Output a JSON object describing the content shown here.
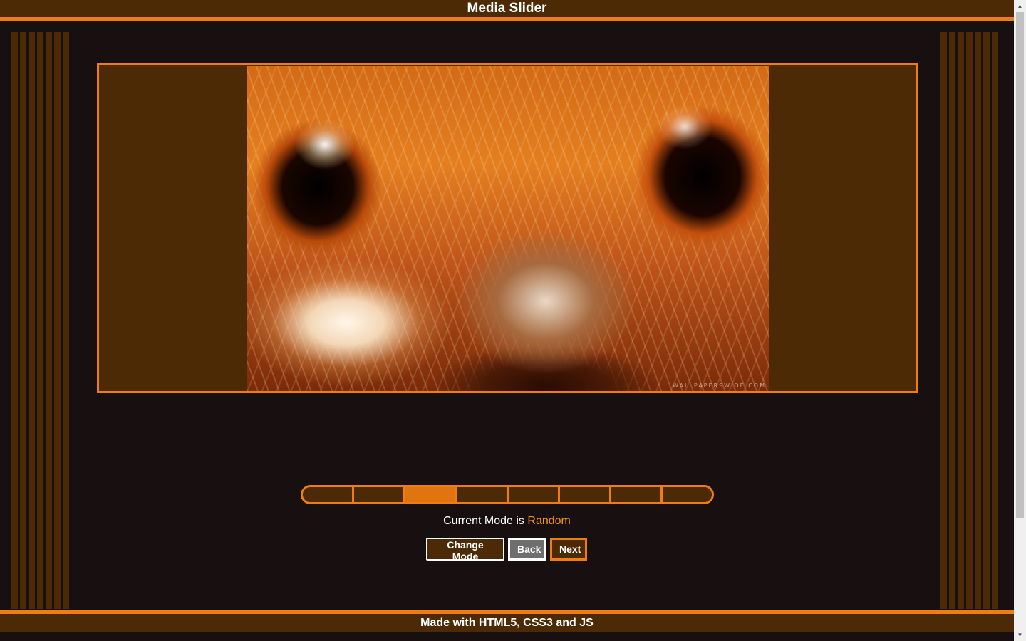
{
  "header": {
    "title": "Media Slider"
  },
  "slider": {
    "watermark": "WALLPAPERSWIDE.COM",
    "image_description_icon": "fractal-lion-face-image",
    "segments": 8,
    "active_segment": 3
  },
  "mode": {
    "prefix": "Current Mode is",
    "value": "Random"
  },
  "controls": {
    "change_mode_label": "Change Mode",
    "back_label": "Back",
    "next_label": "Next"
  },
  "footer": {
    "text": "Made with HTML5, CSS3 and JS"
  },
  "colors": {
    "accent": "#f07d14",
    "panel": "#4d2a06",
    "background": "#181010",
    "active_segment": "#e07510",
    "mode_value": "#f3931c"
  }
}
